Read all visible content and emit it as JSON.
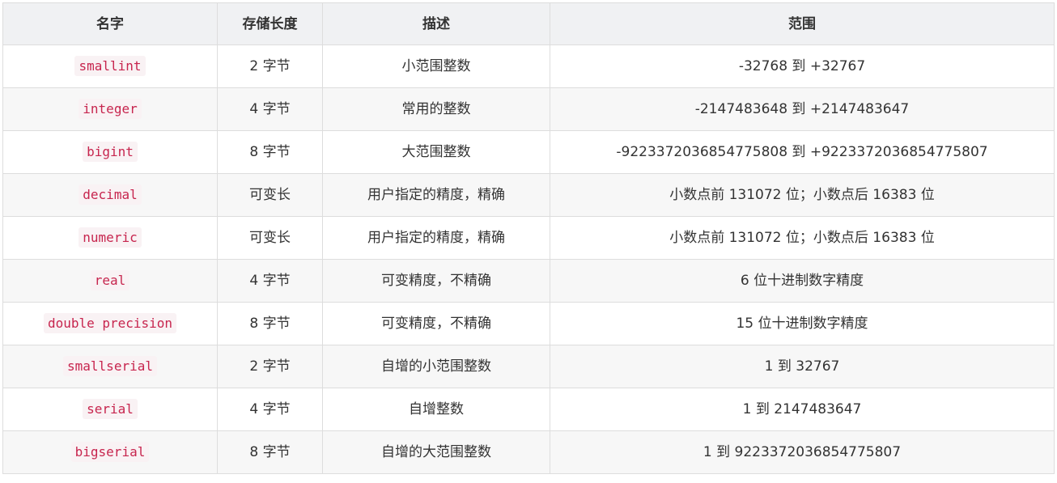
{
  "table": {
    "headers": [
      "名字",
      "存储长度",
      "描述",
      "范围"
    ],
    "rows": [
      {
        "name": "smallint",
        "size": "2 字节",
        "desc": "小范围整数",
        "range": "-32768 到 +32767"
      },
      {
        "name": "integer",
        "size": "4 字节",
        "desc": "常用的整数",
        "range": "-2147483648 到 +2147483647"
      },
      {
        "name": "bigint",
        "size": "8 字节",
        "desc": "大范围整数",
        "range": "-9223372036854775808 到 +9223372036854775807"
      },
      {
        "name": "decimal",
        "size": "可变长",
        "desc": "用户指定的精度，精确",
        "range": "小数点前 131072 位；小数点后 16383 位"
      },
      {
        "name": "numeric",
        "size": "可变长",
        "desc": "用户指定的精度，精确",
        "range": "小数点前 131072 位；小数点后 16383 位"
      },
      {
        "name": "real",
        "size": "4 字节",
        "desc": "可变精度，不精确",
        "range": "6 位十进制数字精度"
      },
      {
        "name": "double precision",
        "size": "8 字节",
        "desc": "可变精度，不精确",
        "range": "15 位十进制数字精度"
      },
      {
        "name": "smallserial",
        "size": "2 字节",
        "desc": "自增的小范围整数",
        "range": "1 到 32767"
      },
      {
        "name": "serial",
        "size": "4 字节",
        "desc": "自增整数",
        "range": "1 到 2147483647"
      },
      {
        "name": "bigserial",
        "size": "8 字节",
        "desc": "自增的大范围整数",
        "range": "1 到 9223372036854775807"
      }
    ]
  },
  "colors": {
    "header_bg": "#f0f1f3",
    "stripe_bg": "#f7f7f7",
    "border": "#dddddd",
    "code_text": "#c7254e",
    "code_bg": "#f9f2f4"
  }
}
